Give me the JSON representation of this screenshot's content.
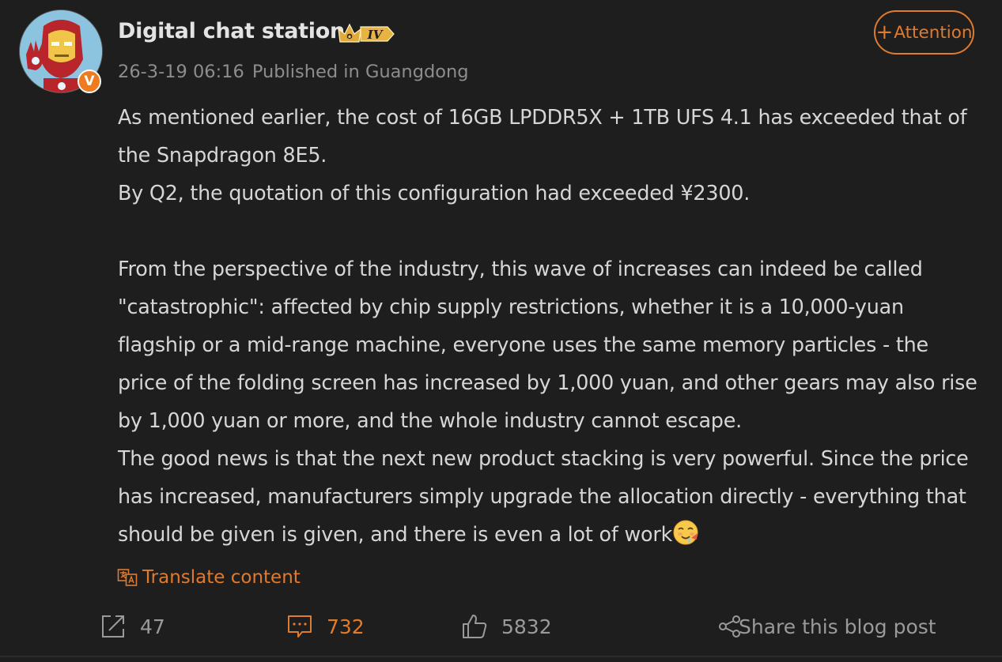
{
  "author": {
    "name": "Digital chat station",
    "level_badge": "IV",
    "verified_badge": "V"
  },
  "meta": {
    "timestamp": "26-3-19 06:16",
    "location": "Published in Guangdong"
  },
  "follow_button": {
    "plus": "+",
    "label": "Attention"
  },
  "content": {
    "paragraphs": [
      "As mentioned earlier, the cost of 16GB LPDDR5X + 1TB UFS 4.1 has exceeded that of the Snapdragon 8E5.",
      "By Q2, the quotation of this configuration had exceeded ¥2300.",
      "",
      "From the perspective of the industry, this wave of increases can indeed be called \"catastrophic\": affected by chip supply restrictions, whether it is a 10,000-yuan flagship or a mid-range machine, everyone uses the same memory particles - the price of the folding screen has increased by 1,000 yuan, and other gears may also rise by 1,000 yuan or more, and the whole industry cannot escape.",
      "The good news is that the next new product stacking is very powerful. Since the price has increased, manufacturers simply upgrade the allocation directly - everything that should be given is given, and there is even a lot of work"
    ],
    "trailing_emoji": "drooling-face-emoji"
  },
  "translate": {
    "label": "Translate content",
    "icon": "translate-icon"
  },
  "actions": {
    "repost_count": "47",
    "comment_count": "732",
    "like_count": "5832",
    "share_label": "Share this blog post"
  },
  "colors": {
    "background": "#1e1e1e",
    "accent": "#e07a2c",
    "text": "#d6d6d6",
    "muted": "#8d8d8d"
  }
}
